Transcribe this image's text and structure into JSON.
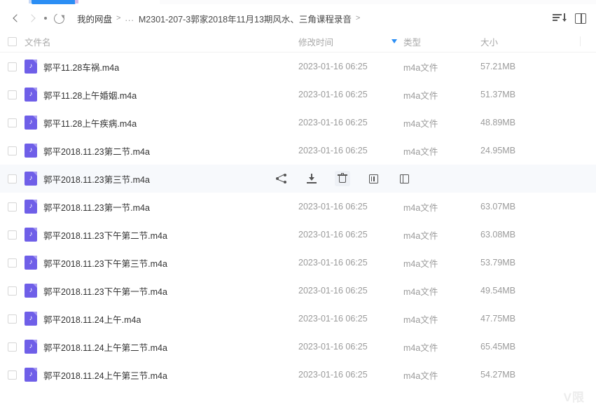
{
  "app": {
    "accent_color": "#2b8ef4",
    "file_icon_color": "#6f5fe8",
    "watermark": "V限"
  },
  "navbar": {
    "back_label": "‹",
    "forward_label": "›",
    "refresh_label": "↻",
    "breadcrumb": {
      "root": "我的网盘",
      "separator": ">",
      "ellipsis": "...",
      "current": "M2301-207-3郭家2018年11月13期风水、三角课程录音",
      "trailing_separator": ">"
    },
    "sort_button_label": "排序",
    "view_button_label": "视图"
  },
  "columns": {
    "name": "文件名",
    "modified": "修改时间",
    "type": "类型",
    "size": "大小"
  },
  "row_actions": [
    {
      "name": "share",
      "label": "分享"
    },
    {
      "name": "download",
      "label": "下载"
    },
    {
      "name": "delete",
      "label": "删除"
    },
    {
      "name": "rename",
      "label": "重命名"
    },
    {
      "name": "more",
      "label": "更多"
    }
  ],
  "files": [
    {
      "name": "郭平11.28车祸.m4a",
      "modified": "2023-01-16 06:25",
      "type": "m4a文件",
      "size": "57.21MB",
      "hovered": false
    },
    {
      "name": "郭平11.28上午婚姻.m4a",
      "modified": "2023-01-16 06:25",
      "type": "m4a文件",
      "size": "51.37MB",
      "hovered": false
    },
    {
      "name": "郭平11.28上午疾病.m4a",
      "modified": "2023-01-16 06:25",
      "type": "m4a文件",
      "size": "48.89MB",
      "hovered": false
    },
    {
      "name": "郭平2018.11.23第二节.m4a",
      "modified": "2023-01-16 06:25",
      "type": "m4a文件",
      "size": "24.95MB",
      "hovered": false
    },
    {
      "name": "郭平2018.11.23第三节.m4a",
      "modified": "",
      "type": "",
      "size": "",
      "hovered": true
    },
    {
      "name": "郭平2018.11.23第一节.m4a",
      "modified": "2023-01-16 06:25",
      "type": "m4a文件",
      "size": "63.07MB",
      "hovered": false
    },
    {
      "name": "郭平2018.11.23下午第二节.m4a",
      "modified": "2023-01-16 06:25",
      "type": "m4a文件",
      "size": "63.08MB",
      "hovered": false
    },
    {
      "name": "郭平2018.11.23下午第三节.m4a",
      "modified": "2023-01-16 06:25",
      "type": "m4a文件",
      "size": "53.79MB",
      "hovered": false
    },
    {
      "name": "郭平2018.11.23下午第一节.m4a",
      "modified": "2023-01-16 06:25",
      "type": "m4a文件",
      "size": "49.54MB",
      "hovered": false
    },
    {
      "name": "郭平2018.11.24上午.m4a",
      "modified": "2023-01-16 06:25",
      "type": "m4a文件",
      "size": "47.75MB",
      "hovered": false
    },
    {
      "name": "郭平2018.11.24上午第二节.m4a",
      "modified": "2023-01-16 06:25",
      "type": "m4a文件",
      "size": "65.45MB",
      "hovered": false
    },
    {
      "name": "郭平2018.11.24上午第三节.m4a",
      "modified": "2023-01-16 06:25",
      "type": "m4a文件",
      "size": "54.27MB",
      "hovered": false
    }
  ]
}
